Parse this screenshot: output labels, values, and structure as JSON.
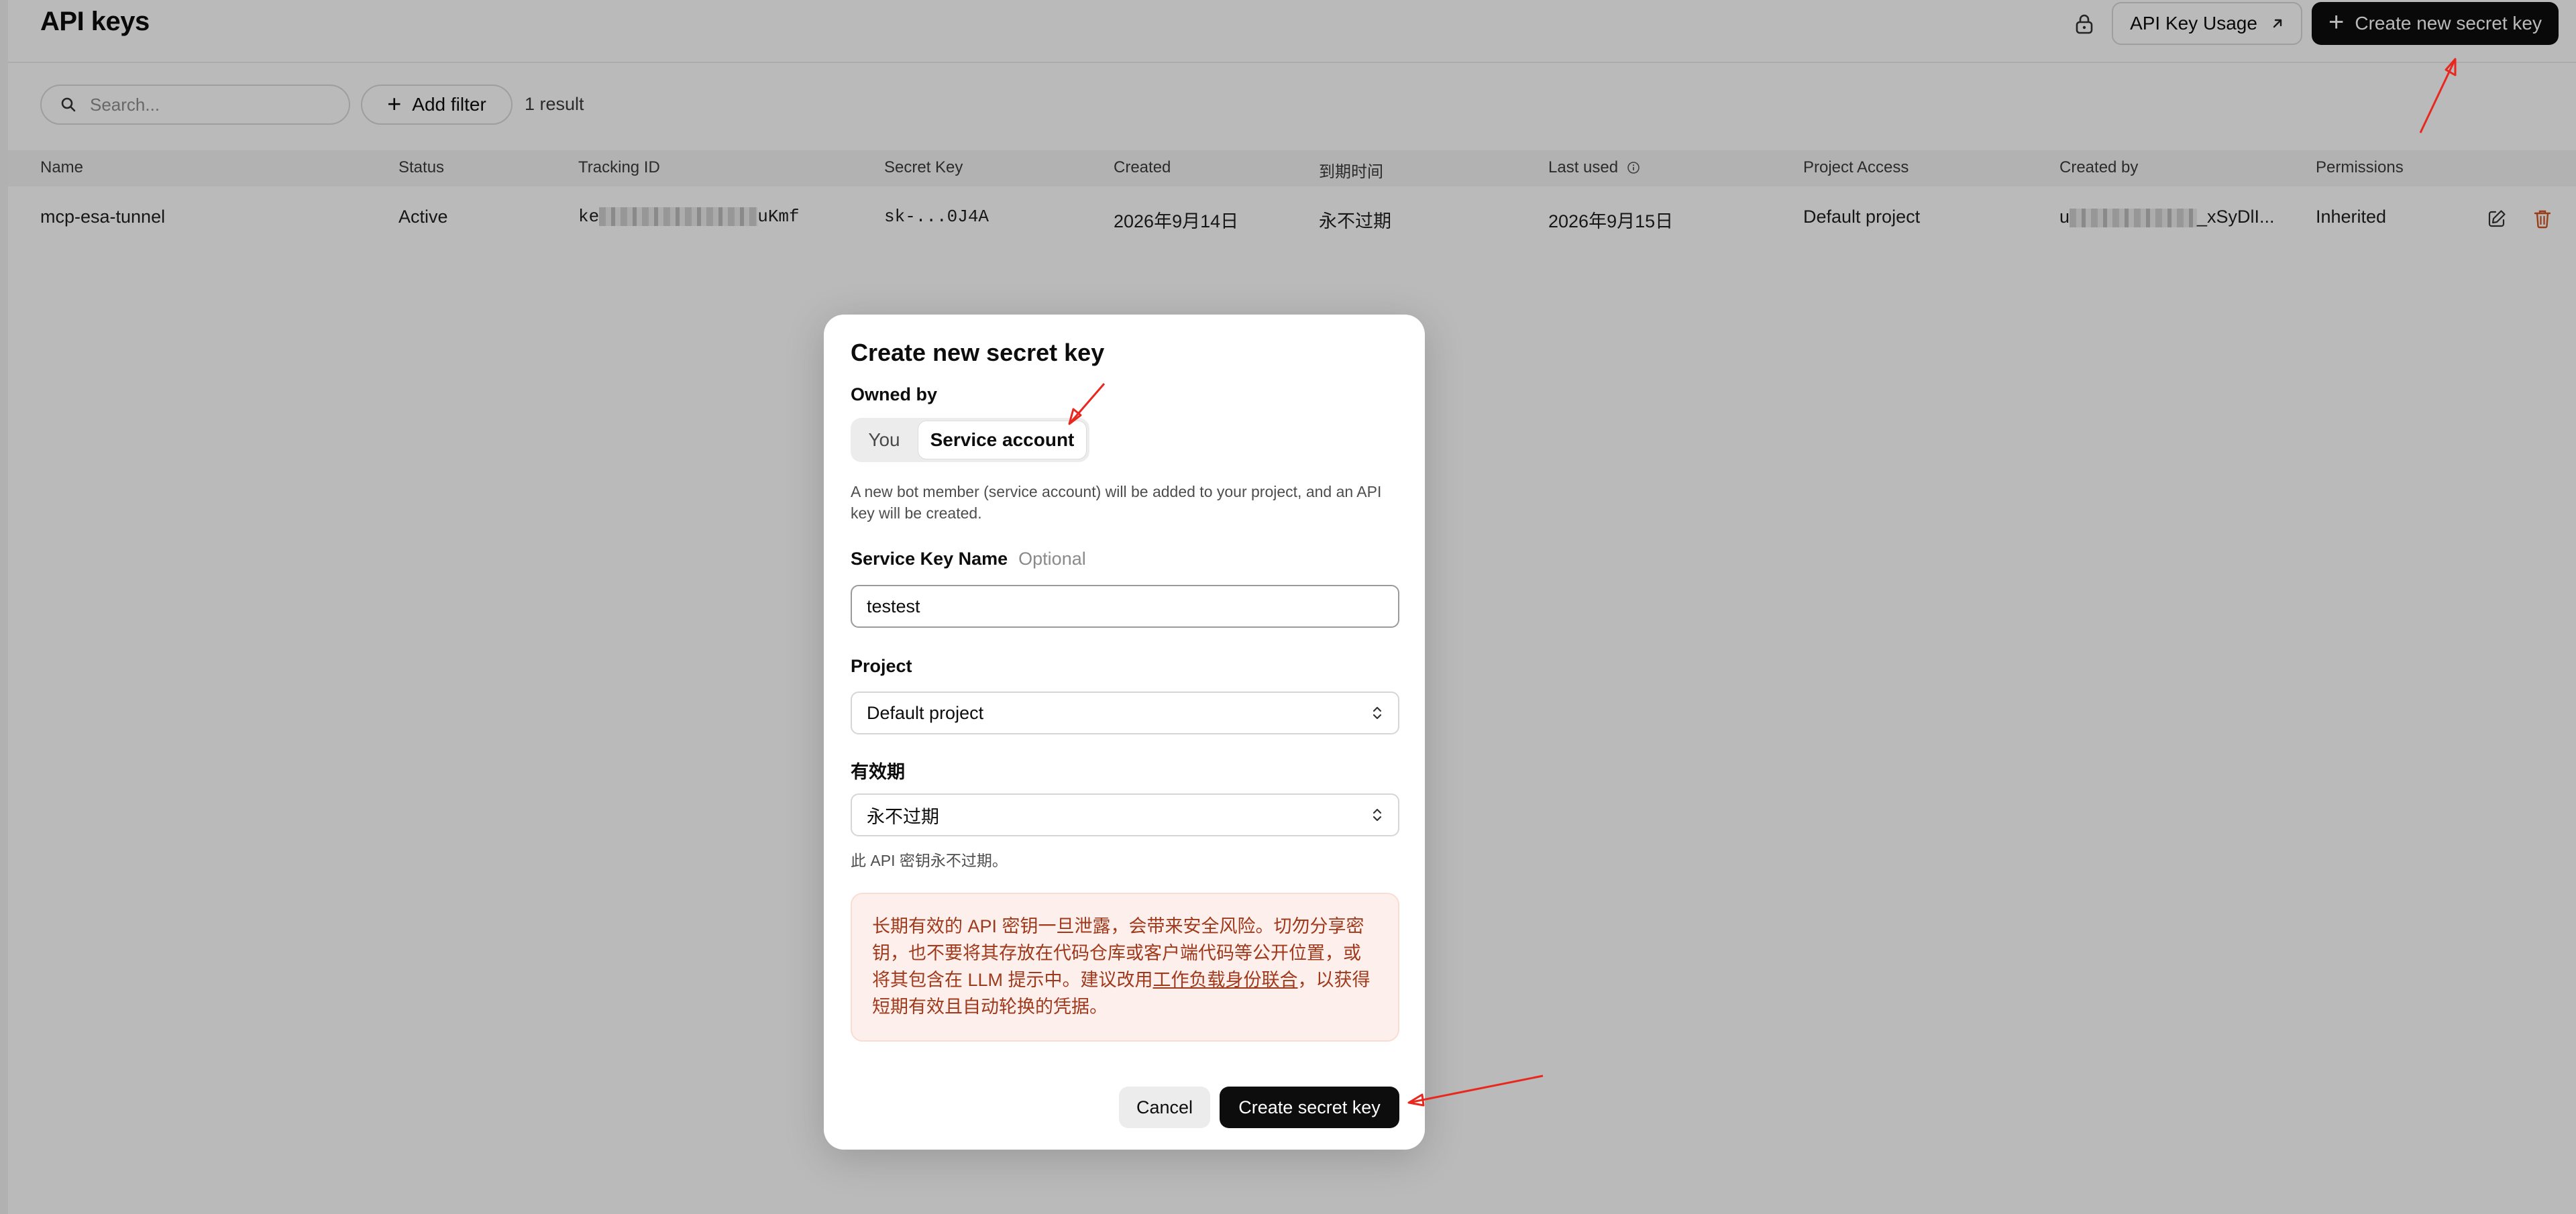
{
  "header": {
    "title": "API keys",
    "usage_button": "API Key Usage",
    "create_button": "Create new secret key"
  },
  "toolbar": {
    "search_placeholder": "Search...",
    "add_filter": "Add filter",
    "result_count": "1 result"
  },
  "table": {
    "columns": [
      "Name",
      "Status",
      "Tracking ID",
      "Secret Key",
      "Created",
      "到期时间",
      "Last used",
      "Project Access",
      "Created by",
      "Permissions"
    ],
    "rows": [
      {
        "name": "mcp-esa-tunnel",
        "status": "Active",
        "tracking_id_prefix": "ke",
        "tracking_id_suffix": "uKmf",
        "secret_key": "sk-...0J4A",
        "created": "2026年9月14日",
        "expires": "永不过期",
        "last_used": "2026年9月15日",
        "project_access": "Default project",
        "created_by_prefix": "u",
        "created_by_suffix": "_xSyDlI...",
        "permissions": "Inherited"
      }
    ]
  },
  "modal": {
    "title": "Create new secret key",
    "owned_by_label": "Owned by",
    "owner_options": [
      "You",
      "Service account"
    ],
    "owner_selected": "Service account",
    "help_text": "A new bot member (service account) will be added to your project, and an API key will be created.",
    "name_label": "Service Key Name",
    "name_optional": "Optional",
    "name_value": "testest",
    "project_label": "Project",
    "project_value": "Default project",
    "expiry_label": "有效期",
    "expiry_value": "永不过期",
    "expiry_note": "此 API 密钥永不过期。",
    "warning_before": "长期有效的 API 密钥一旦泄露，会带来安全风险。切勿分享密钥，也不要将其存放在代码仓库或客户端代码等公开位置，或将其包含在 LLM 提示中。建议改用",
    "warning_link": "工作负载身份联合",
    "warning_after": "，以获得短期有效且自动轮换的凭据。",
    "cancel": "Cancel",
    "submit": "Create secret key"
  },
  "colors": {
    "accent_dark": "#0d0d0d",
    "warning_text": "#a0391c",
    "warning_bg": "#fdf0ec",
    "delete_icon": "#d4531f",
    "annotation_arrow": "#e8281e"
  }
}
